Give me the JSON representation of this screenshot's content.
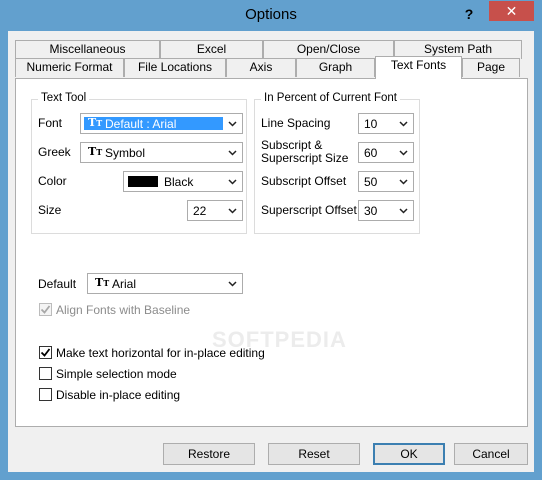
{
  "window": {
    "title": "Options",
    "help_label": "?",
    "close_label": "✕"
  },
  "tabs_row1": [
    "Miscellaneous",
    "Excel",
    "Open/Close",
    "System Path"
  ],
  "tabs_row2": [
    "Numeric Format",
    "File Locations",
    "Axis",
    "Graph",
    "Text Fonts",
    "Page"
  ],
  "active_tab": "Text Fonts",
  "text_tool": {
    "group_title": "Text Tool",
    "font_label": "Font",
    "font_value": "Default : Arial",
    "greek_label": "Greek",
    "greek_value": "Symbol",
    "color_label": "Color",
    "color_value": "Black",
    "color_swatch": "#000000",
    "size_label": "Size",
    "size_value": "22"
  },
  "percent": {
    "group_title": "In Percent of Current Font",
    "line_spacing_label": "Line Spacing",
    "line_spacing_value": "10",
    "subsup_label_1": "Subscript &",
    "subsup_label_2": "Superscript Size",
    "subsup_value": "60",
    "sub_offset_label": "Subscript Offset",
    "sub_offset_value": "50",
    "sup_offset_label": "Superscript Offset",
    "sup_offset_value": "30"
  },
  "default_font": {
    "label": "Default",
    "value": "Arial"
  },
  "checkboxes": {
    "align_baseline": {
      "label": "Align Fonts with Baseline",
      "checked": true,
      "disabled": true
    },
    "make_horizontal": {
      "label": "Make text horizontal for in-place editing",
      "checked": true
    },
    "simple_selection": {
      "label": "Simple selection mode",
      "checked": false
    },
    "disable_inplace": {
      "label": "Disable in-place editing",
      "checked": false
    }
  },
  "buttons": {
    "restore": "Restore",
    "reset": "Reset",
    "ok": "OK",
    "cancel": "Cancel"
  },
  "watermark": "SOFTPEDIA",
  "icons": {
    "font_type": "tt-font-icon",
    "dropdown": "chevron-down-icon"
  }
}
